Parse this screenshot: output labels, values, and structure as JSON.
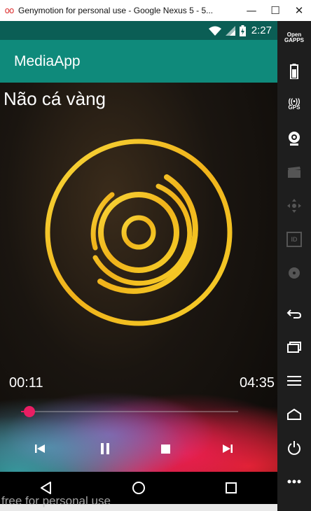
{
  "window": {
    "title": "Genymotion for personal use - Google Nexus 5 - 5...",
    "logo_glyph": "oo",
    "minimize": "—",
    "maximize": "☐",
    "close": "✕"
  },
  "statusbar": {
    "time": "2:27"
  },
  "appbar": {
    "title": "MediaApp"
  },
  "player": {
    "song_title": "Não cá vàng",
    "elapsed": "00:11",
    "total": "04:35",
    "progress": 0.04,
    "accent_color": "#e91e63"
  },
  "controls": [
    "previous-icon",
    "pause-icon",
    "stop-icon",
    "next-icon"
  ],
  "watermark": "free for personal use",
  "sidepanel": {
    "open_gapps_line1": "Open",
    "open_gapps_line2": "GAPPS",
    "gps_label": "GPS",
    "id_label": "ID"
  },
  "colors": {
    "statusbar": "#0b5e55",
    "appbar": "#0f8a7b",
    "disc": "#f2c21a"
  }
}
